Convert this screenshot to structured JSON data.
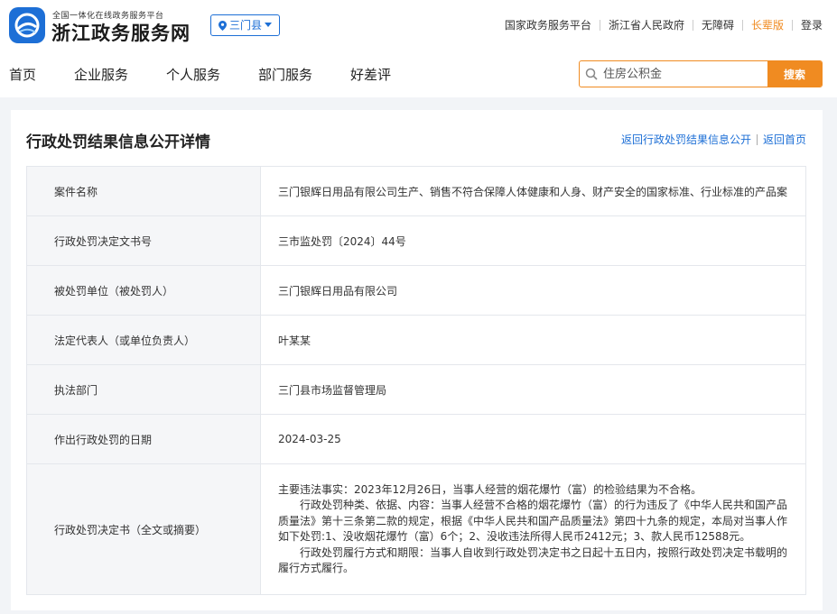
{
  "header": {
    "brand_sub": "全国一体化在线政务服务平台",
    "brand_main": "浙江政务服务网",
    "region": "三门县",
    "top_links": [
      "国家政务服务平台",
      "浙江省人民政府",
      "无障碍",
      "长辈版",
      "登录"
    ]
  },
  "nav": {
    "items": [
      "首页",
      "企业服务",
      "个人服务",
      "部门服务",
      "好差评"
    ]
  },
  "search": {
    "placeholder": "住房公积金",
    "button": "搜索"
  },
  "page": {
    "title": "行政处罚结果信息公开详情",
    "links": [
      "返回行政处罚结果信息公开",
      "返回首页"
    ]
  },
  "details": {
    "rows": [
      {
        "label": "案件名称",
        "value": "三门银辉日用品有限公司生产、销售不符合保障人体健康和人身、财产安全的国家标准、行业标准的产品案"
      },
      {
        "label": "行政处罚决定文书号",
        "value": "三市监处罚〔2024〕44号"
      },
      {
        "label": "被处罚单位（被处罚人）",
        "value": "三门银辉日用品有限公司"
      },
      {
        "label": "法定代表人（或单位负责人）",
        "value": "叶某某"
      },
      {
        "label": "执法部门",
        "value": "三门县市场监督管理局"
      },
      {
        "label": "作出行政处罚的日期",
        "value": "2024-03-25"
      }
    ],
    "decision_label": "行政处罚决定书（全文或摘要）",
    "decision_paragraphs": [
      "主要违法事实：2023年12月26日，当事人经营的烟花爆竹（富）的检验结果为不合格。",
      "行政处罚种类、依据、内容：当事人经营不合格的烟花爆竹（富）的行为违反了《中华人民共和国产品质量法》第十三条第二款的规定，根据《中华人民共和国产品质量法》第四十九条的规定，本局对当事人作如下处罚:1、没收烟花爆竹（富）6个；2、没收违法所得人民币2412元；3、款人民币12588元。",
      "行政处罚履行方式和期限：当事人自收到行政处罚决定书之日起十五日内，按照行政处罚决定书载明的履行方式履行。"
    ]
  }
}
